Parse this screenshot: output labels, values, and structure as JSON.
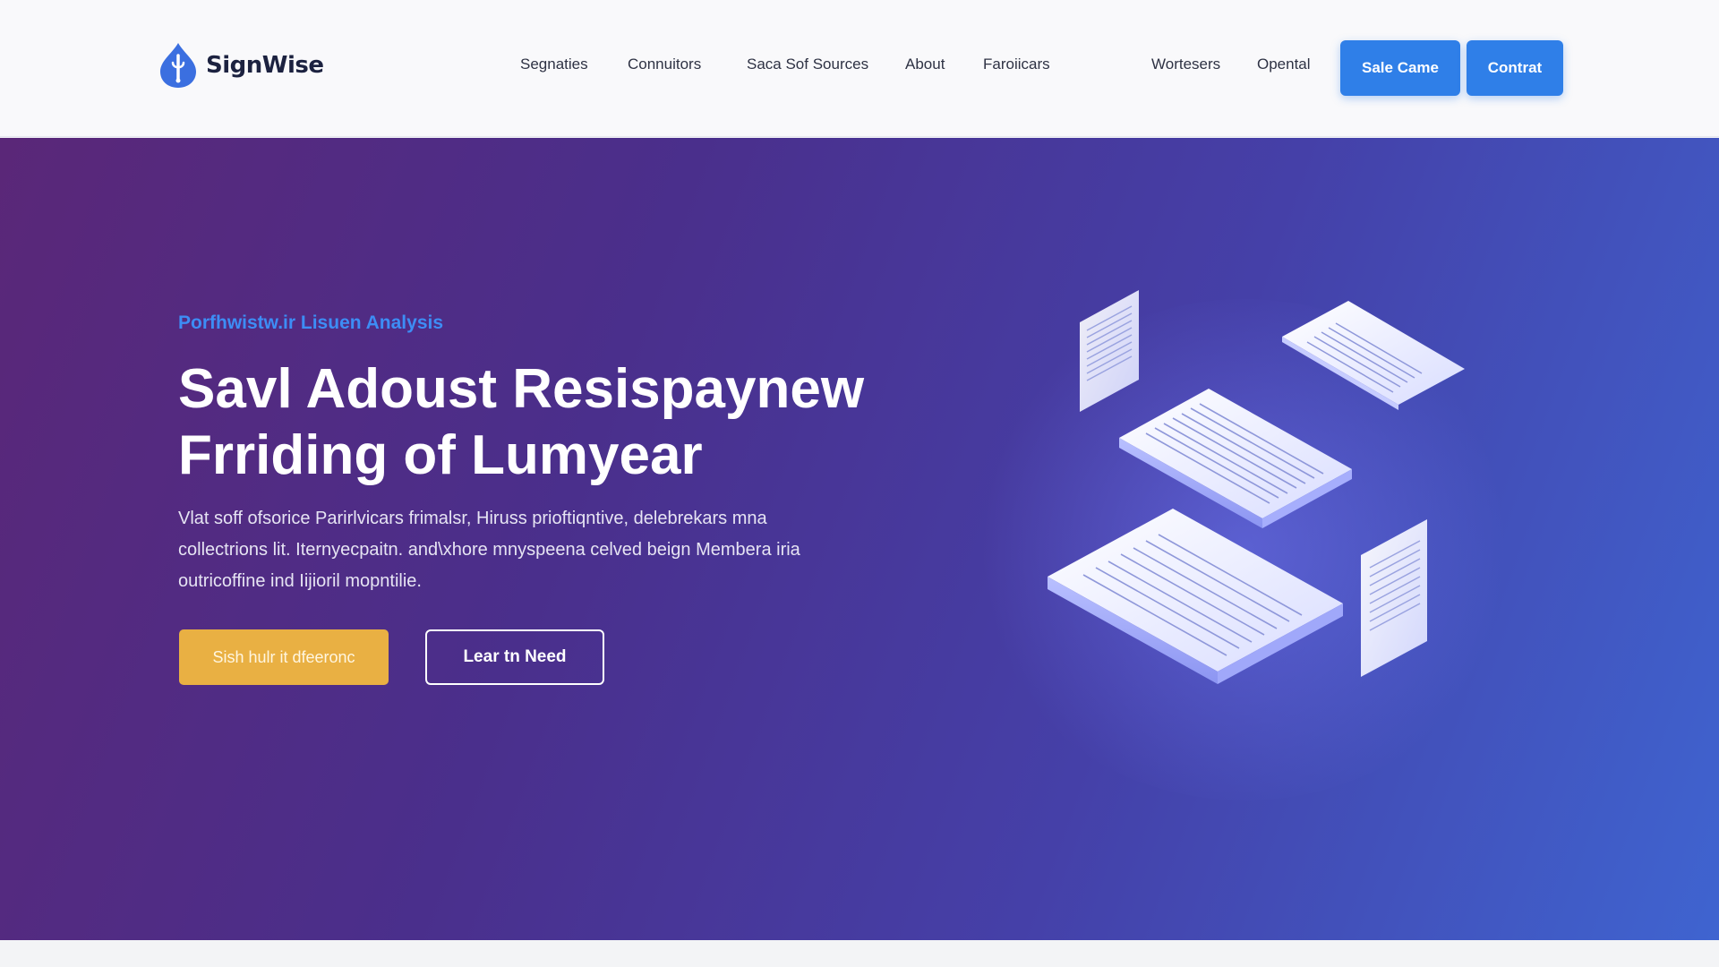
{
  "brand": {
    "name": "SignWise",
    "logo_icon": "pen-nib-drop-icon",
    "logo_color": "#3b6fe0"
  },
  "nav": {
    "items": [
      {
        "label": "Segnaties"
      },
      {
        "label": "Connuitors"
      },
      {
        "label": "Saca Sof Sources"
      },
      {
        "label": "About"
      },
      {
        "label": "Faroiicars"
      },
      {
        "label": "Wortesers"
      },
      {
        "label": "Opental"
      }
    ],
    "buttons": {
      "primary": "Sale Came",
      "secondary": "Contrat"
    }
  },
  "hero": {
    "eyebrow": "Porfhwistw.ir Lisuen Analysis",
    "headline": [
      "Savl Adoust Resispaynew",
      "Frriding of Lumyear"
    ],
    "paragraph": [
      "Vlat soff ofsorice Parirlvicars frimalsr, Hiruss prioftiqntive, delebrekars mna",
      "collectrions lit. Iternyecpaitn. and\\xhore mnyspeena celved beign Membera iria",
      "outricoffine ind Iijioril mopntilie."
    ],
    "cta_primary": "Sish hulr it dfeeronc",
    "cta_secondary": "Lear tn Need",
    "illustration_icon": "floating-documents-icon"
  },
  "colors": {
    "accent_blue": "#2f7fe8",
    "eyebrow_blue": "#3d8df5",
    "cta_yellow": "#e9b043",
    "hero_gradient_start": "#5a2778",
    "hero_gradient_end": "#3f64d0"
  }
}
